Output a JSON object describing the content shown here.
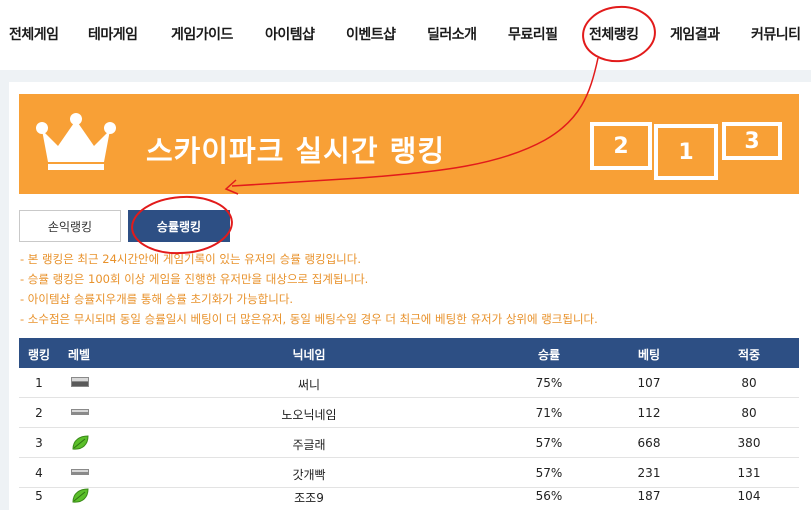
{
  "nav": {
    "items": [
      "전체게임",
      "테마게임",
      "게임가이드",
      "아이템샵",
      "이벤트샵",
      "딜러소개",
      "무료리필",
      "전체랭킹",
      "게임결과",
      "커뮤니티"
    ]
  },
  "banner": {
    "title": "스카이파크 실시간 랭킹",
    "podium": [
      "2",
      "1",
      "3"
    ]
  },
  "tabs": {
    "profit": "손익랭킹",
    "winrate": "승률랭킹"
  },
  "notes": [
    "- 본 랭킹은 최근 24시간안에 게임기록이 있는 유저의 승률 랭킹입니다.",
    "- 승률 랭킹은 100회 이상 게임을 진행한 유저만을 대상으로 집계됩니다.",
    "- 아이템샵 승률지우개를 통해 승률 초기화가 가능합니다.",
    "- 소수점은 무시되며 동일 승률일시 베팅이 더 많은유저, 동일 베팅수일 경우 더 최근에 베팅한 유저가 상위에 랭크됩니다."
  ],
  "table": {
    "headers": [
      "랭킹",
      "레벨",
      "닉네임",
      "승률",
      "베팅",
      "적중"
    ],
    "rows": [
      {
        "rank": "1",
        "level": "bar-icon",
        "nick": "써니",
        "winrate": "75%",
        "bets": "107",
        "hits": "80"
      },
      {
        "rank": "2",
        "level": "bar-icon",
        "nick": "노오닉네임",
        "winrate": "71%",
        "bets": "112",
        "hits": "80"
      },
      {
        "rank": "3",
        "level": "leaf-icon",
        "nick": "주글래",
        "winrate": "57%",
        "bets": "668",
        "hits": "380"
      },
      {
        "rank": "4",
        "level": "bar-icon",
        "nick": "갓개빡",
        "winrate": "57%",
        "bets": "231",
        "hits": "131"
      },
      {
        "rank": "5",
        "level": "leaf-icon",
        "nick": "조조9",
        "winrate": "56%",
        "bets": "187",
        "hits": "104"
      }
    ]
  },
  "colors": {
    "banner": "#f8a036",
    "accent_navy": "#2d4f84",
    "note_text": "#e8922c",
    "annotation_red": "#e21b1b"
  }
}
